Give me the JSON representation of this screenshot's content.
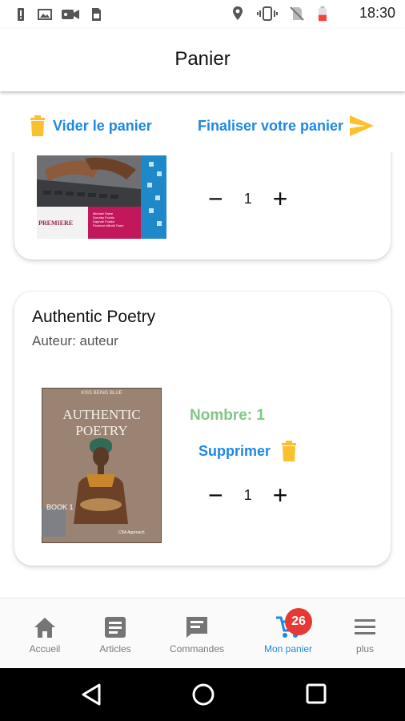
{
  "status_bar": {
    "time": "18:30",
    "left_icons": [
      "alert-icon",
      "image-icon",
      "video-icon",
      "sim-icon"
    ],
    "right_icons": [
      "location-icon",
      "vibrate-icon",
      "no-sim-icon",
      "battery-icon"
    ],
    "battery_color": "#f44336"
  },
  "app_bar": {
    "title": "Panier"
  },
  "actions": {
    "clear_label": "Vider le panier",
    "checkout_label": "Finaliser votre panier"
  },
  "colors": {
    "accent_blue": "#1e88e5",
    "accent_amber": "#fbc02d",
    "count_green": "#81c784",
    "badge_red": "#e53935"
  },
  "cart": {
    "items": [
      {
        "cover_text": "PREMIERE",
        "cover_authors": [
          "Michael Saine",
          "Dorothy Fochic",
          "Daphne Folake",
          "Florence Mbotti Tioeh"
        ],
        "quantity": "1"
      },
      {
        "title": "Authentic Poetry",
        "author": "Auteur: auteur",
        "cover_top": "KISS BEING BLUE",
        "cover_title_line1": "AUTHENTIC",
        "cover_title_line2": "POETRY",
        "cover_book": "BOOK 1",
        "cover_approach": "CBA Approach",
        "count": "Nombre: 1",
        "remove_label": "Supprimer",
        "quantity": "1"
      }
    ]
  },
  "bottom_nav": {
    "items": [
      {
        "label": "Accueil",
        "icon": "home-icon"
      },
      {
        "label": "Articles",
        "icon": "article-icon"
      },
      {
        "label": "Commandes",
        "icon": "message-icon"
      },
      {
        "label": "Mon panier",
        "icon": "cart-icon",
        "badge": "26",
        "active": true
      },
      {
        "label": "plus",
        "icon": "menu-icon"
      }
    ]
  }
}
